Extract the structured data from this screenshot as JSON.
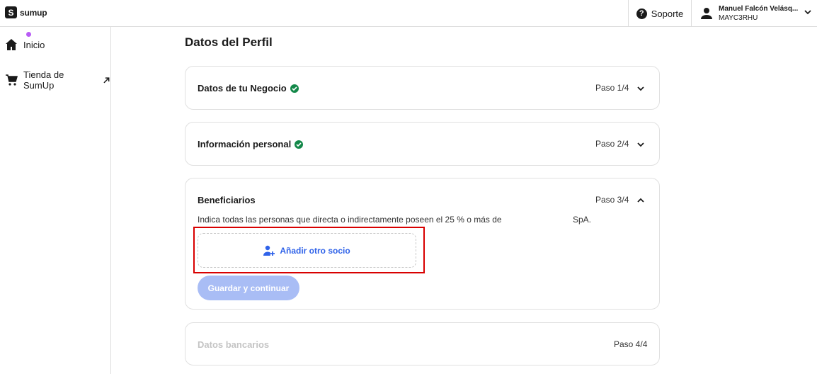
{
  "header": {
    "logo_text": "sumup",
    "logo_mark": "S",
    "support_label": "Soporte",
    "user_name": "Manuel Falcón Velásq...",
    "user_id": "MAYC3RHU"
  },
  "sidebar": {
    "items": [
      {
        "label": "Inicio",
        "icon": "home-icon"
      },
      {
        "label": "Tienda de SumUp",
        "icon": "cart-icon"
      }
    ]
  },
  "main": {
    "title": "Datos del Perfil",
    "sections": [
      {
        "title": "Datos de tu Negocio",
        "step": "Paso 1/4",
        "complete": true
      },
      {
        "title": "Información personal",
        "step": "Paso 2/4",
        "complete": true
      },
      {
        "title": "Beneficiarios",
        "step": "Paso 3/4",
        "description": "Indica todas las personas que directa o indirectamente poseen el 25 % o más de",
        "description_suffix": "SpA.",
        "add_label": "Añadir otro socio",
        "save_label": "Guardar y continuar"
      },
      {
        "title": "Datos bancarios",
        "step": "Paso 4/4"
      }
    ]
  },
  "colors": {
    "accent": "#3063e9",
    "success": "#138849",
    "highlight": "#d80000",
    "disabled_button": "#a9bdf5"
  }
}
